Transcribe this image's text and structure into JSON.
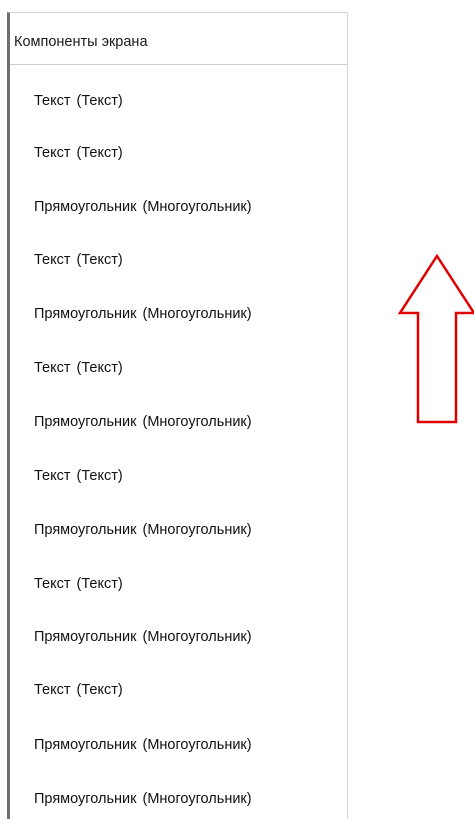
{
  "panel": {
    "title": "Компоненты экрана",
    "items": [
      {
        "name": "Текст",
        "type": "(Текст)"
      },
      {
        "name": "Текст",
        "type": "(Текст)"
      },
      {
        "name": "Прямоугольник",
        "type": "(Многоугольник)"
      },
      {
        "name": "Текст",
        "type": "(Текст)"
      },
      {
        "name": "Прямоугольник",
        "type": "(Многоугольник)"
      },
      {
        "name": "Текст",
        "type": "(Текст)"
      },
      {
        "name": "Прямоугольник",
        "type": "(Многоугольник)"
      },
      {
        "name": "Текст",
        "type": "(Текст)"
      },
      {
        "name": "Прямоугольник",
        "type": "(Многоугольник)"
      },
      {
        "name": "Текст",
        "type": "(Текст)"
      },
      {
        "name": "Прямоугольник",
        "type": "(Многоугольник)"
      },
      {
        "name": "Текст",
        "type": "(Текст)"
      },
      {
        "name": "Прямоугольник",
        "type": "(Многоугольник)"
      },
      {
        "name": "Прямоугольник",
        "type": "(Многоугольник)"
      }
    ]
  },
  "annotation": {
    "icon": "up-arrow-icon",
    "color": "#e00000"
  }
}
